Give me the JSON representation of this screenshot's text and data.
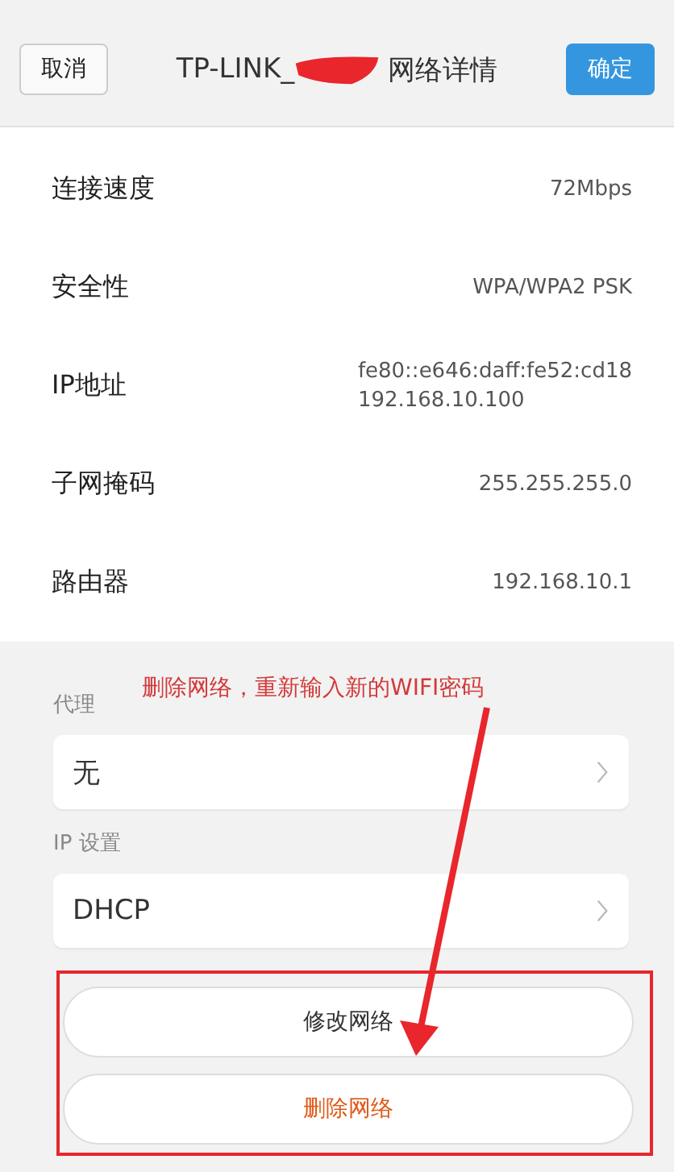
{
  "header": {
    "cancel": "取消",
    "title_prefix": "TP-LINK_",
    "title_suffix": "网络详情",
    "confirm": "确定"
  },
  "details": [
    {
      "label": "连接速度",
      "values": [
        "72Mbps"
      ]
    },
    {
      "label": "安全性",
      "values": [
        "WPA/WPA2 PSK"
      ]
    },
    {
      "label": "IP地址",
      "values": [
        "fe80::e646:daff:fe52:cd18",
        "192.168.10.100"
      ]
    },
    {
      "label": "子网掩码",
      "values": [
        "255.255.255.0"
      ]
    },
    {
      "label": "路由器",
      "values": [
        "192.168.10.1"
      ]
    }
  ],
  "settings": [
    {
      "label": "代理",
      "value": "无"
    },
    {
      "label": "IP 设置",
      "value": "DHCP"
    }
  ],
  "actions": [
    {
      "label": "修改网络",
      "kind": "normal"
    },
    {
      "label": "删除网络",
      "kind": "danger"
    }
  ],
  "annotation": {
    "text": "删除网络，重新输入新的WIFI密码"
  }
}
